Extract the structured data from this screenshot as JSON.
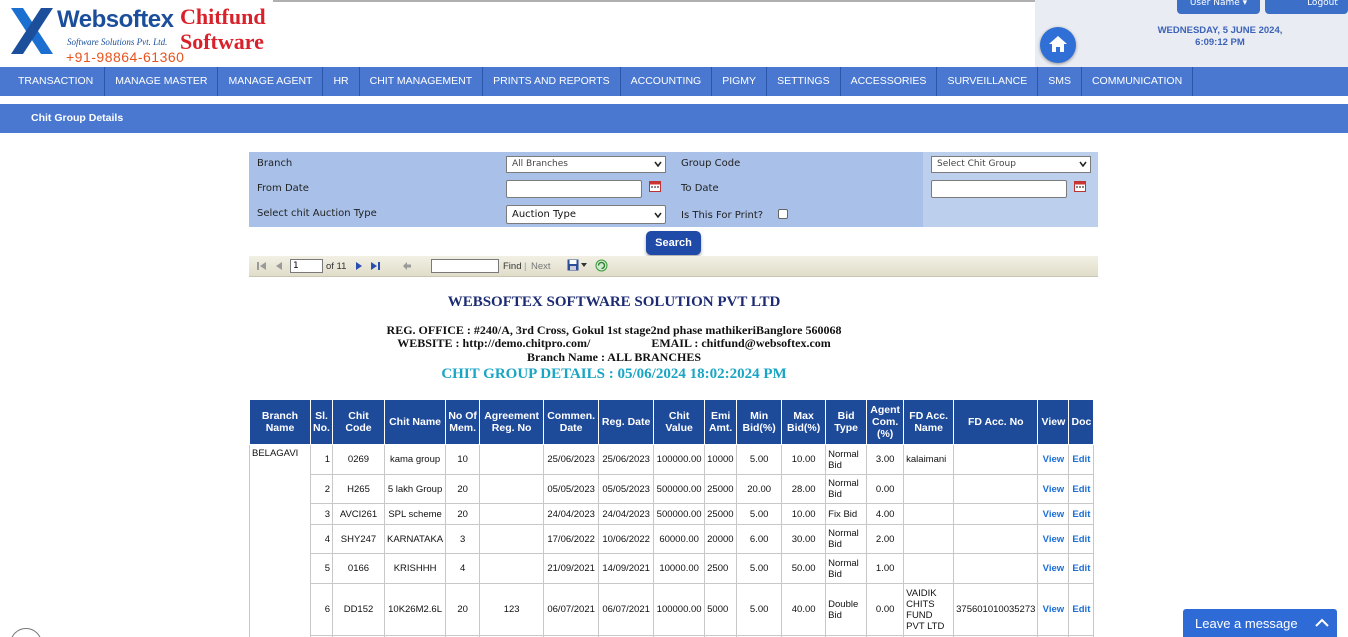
{
  "logo": {
    "brand": "Websoftex",
    "sub": "Software Solutions Pvt. Ltd.",
    "phone": "+91-98864-61360",
    "chit": "Chitfund",
    "software": "Software"
  },
  "header": {
    "date": "WEDNESDAY, 5 JUNE 2024,",
    "time": "6:09:12 PM",
    "user_btn": "User Name ▾",
    "logout_btn": "Logout"
  },
  "nav": [
    "TRANSACTION",
    "MANAGE MASTER",
    "MANAGE AGENT",
    "HR",
    "CHIT MANAGEMENT",
    "PRINTS AND REPORTS",
    "ACCOUNTING",
    "PIGMY",
    "SETTINGS",
    "ACCESSORIES",
    "SURVEILLANCE",
    "SMS",
    "COMMUNICATION"
  ],
  "page_title": "Chit Group Details",
  "filters": {
    "branch_label": "Branch",
    "branch_value": "All Branches",
    "group_label": "Group Code",
    "group_value": "Select Chit Group",
    "from_label": "From Date",
    "to_label": "To Date",
    "auction_label": "Select chit Auction Type",
    "auction_value": "Auction Type",
    "print_label": "Is This For Print?",
    "search": "Search"
  },
  "toolbar": {
    "page": "1",
    "of": "of 11",
    "find": "Find",
    "sep": "|",
    "next": "Next"
  },
  "report": {
    "company": "WEBSOFTEX SOFTWARE SOLUTION PVT LTD",
    "office": "REG. OFFICE :  #240/A, 3rd Cross, Gokul 1st stage2nd phase mathikeriBanglore 560068",
    "website": "WEBSITE : http://demo.chitpro.com/",
    "email": "EMAIL : chitfund@websoftex.com",
    "branch": "Branch Name : ALL BRANCHES",
    "title": "CHIT GROUP DETAILS : 05/06/2024 18:02:2024 PM"
  },
  "table": {
    "headers": [
      "Branch Name",
      "Sl. No.",
      "Chit Code",
      "Chit Name",
      "No Of Mem.",
      "Agreement Reg. No",
      "Commen. Date",
      "Reg. Date",
      "Chit Value",
      "Emi Amt.",
      "Min Bid(%)",
      "Max Bid(%)",
      "Bid Type",
      "Agent Com. (%)",
      "FD Acc. Name",
      "FD Acc. No",
      "View",
      "Doc"
    ],
    "branch": "BELAGAVI",
    "rows": [
      {
        "sl": "1",
        "code": "0269",
        "name": "kama group",
        "mem": "10",
        "agr": "",
        "comm": "25/06/2023",
        "reg": "25/06/2023",
        "value": "100000.00",
        "emi": "10000",
        "min": "5.00",
        "max": "10.00",
        "bid": "Normal Bid",
        "agent": "3.00",
        "fdname": "kalaimani",
        "fdno": "",
        "view": "View",
        "doc": "Edit"
      },
      {
        "sl": "2",
        "code": "H265",
        "name": "5 lakh Group",
        "mem": "20",
        "agr": "",
        "comm": "05/05/2023",
        "reg": "05/05/2023",
        "value": "500000.00",
        "emi": "25000",
        "min": "20.00",
        "max": "28.00",
        "bid": "Normal Bid",
        "agent": "0.00",
        "fdname": "",
        "fdno": "",
        "view": "View",
        "doc": "Edit"
      },
      {
        "sl": "3",
        "code": "AVCI261",
        "name": "SPL scheme",
        "mem": "20",
        "agr": "",
        "comm": "24/04/2023",
        "reg": "24/04/2023",
        "value": "500000.00",
        "emi": "25000",
        "min": "5.00",
        "max": "10.00",
        "bid": "Fix Bid",
        "agent": "4.00",
        "fdname": "",
        "fdno": "",
        "view": "View",
        "doc": "Edit"
      },
      {
        "sl": "4",
        "code": "SHY247",
        "name": "KARNATAKA",
        "mem": "3",
        "agr": "",
        "comm": "17/06/2022",
        "reg": "10/06/2022",
        "value": "60000.00",
        "emi": "20000",
        "min": "6.00",
        "max": "30.00",
        "bid": "Normal Bid",
        "agent": "2.00",
        "fdname": "",
        "fdno": "",
        "view": "View",
        "doc": "Edit"
      },
      {
        "sl": "5",
        "code": "0166",
        "name": "KRISHHH",
        "mem": "4",
        "agr": "",
        "comm": "21/09/2021",
        "reg": "14/09/2021",
        "value": "10000.00",
        "emi": "2500",
        "min": "5.00",
        "max": "50.00",
        "bid": "Normal Bid",
        "agent": "1.00",
        "fdname": "",
        "fdno": "",
        "view": "View",
        "doc": "Edit"
      },
      {
        "sl": "6",
        "code": "DD152",
        "name": "10K26M2.6L",
        "mem": "20",
        "agr": "123",
        "comm": "06/07/2021",
        "reg": "06/07/2021",
        "value": "100000.00",
        "emi": "5000",
        "min": "5.00",
        "max": "40.00",
        "bid": "Double Bid",
        "agent": "0.00",
        "fdname": "VAIDIK CHITS FUND PVT LTD",
        "fdno": "375601010035273",
        "view": "View",
        "doc": "Edit"
      }
    ]
  },
  "chat": {
    "label": "Leave a message"
  }
}
